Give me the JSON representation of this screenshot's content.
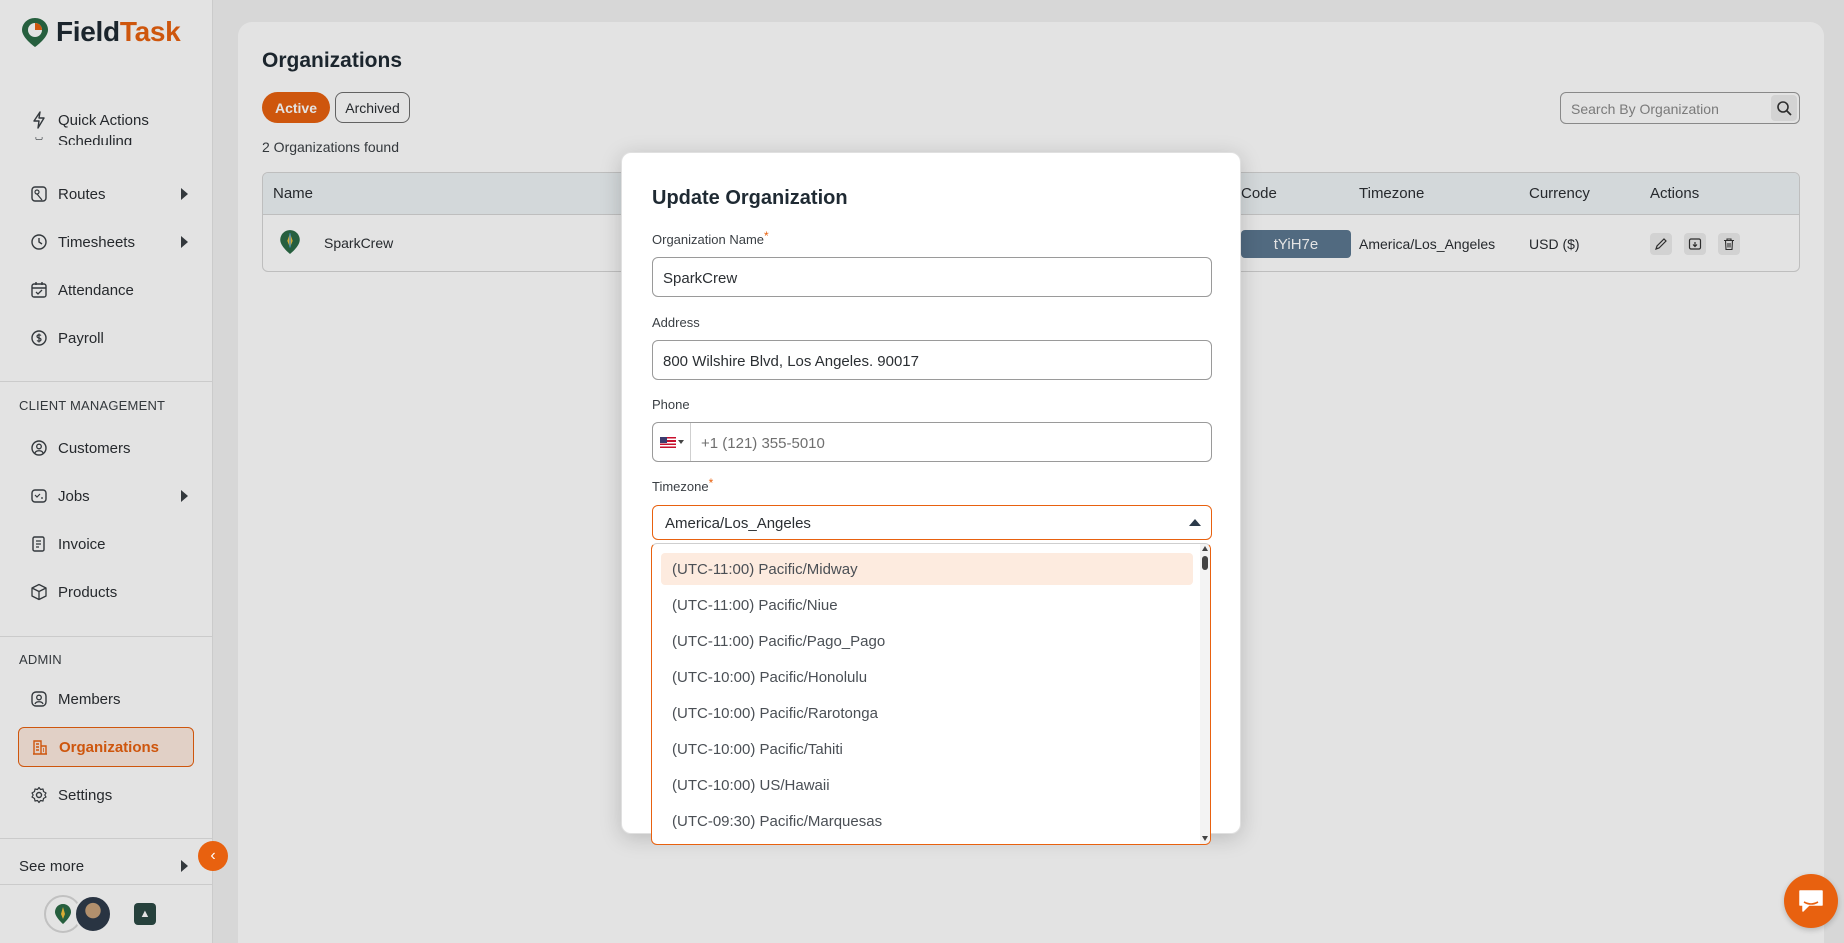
{
  "brand": {
    "name_main": "Field",
    "name_accent": "Task",
    "accent_color": "#e8610f"
  },
  "sidebar": {
    "items_top": [
      {
        "label": "Quick Actions",
        "icon": "bolt-icon"
      },
      {
        "label": "Scheduling",
        "icon": "calendar-icon"
      },
      {
        "label": "Routes",
        "icon": "map-icon"
      },
      {
        "label": "Timesheets",
        "icon": "clock-icon"
      },
      {
        "label": "Attendance",
        "icon": "calendar-check-icon"
      },
      {
        "label": "Payroll",
        "icon": "dollar-icon"
      }
    ],
    "client_section": "CLIENT MANAGEMENT",
    "client_items": [
      {
        "label": "Customers",
        "icon": "user-circle-icon"
      },
      {
        "label": "Jobs",
        "icon": "briefcase-icon"
      },
      {
        "label": "Invoice",
        "icon": "invoice-icon"
      },
      {
        "label": "Products",
        "icon": "box-icon"
      }
    ],
    "admin_section": "ADMIN",
    "admin_items": [
      {
        "label": "Members",
        "icon": "user-icon"
      },
      {
        "label": "Organizations",
        "icon": "building-icon"
      },
      {
        "label": "Settings",
        "icon": "gear-icon"
      }
    ],
    "see_more": "See more"
  },
  "page": {
    "title": "Organizations",
    "tabs": {
      "active": "Active",
      "archived": "Archived"
    },
    "found": "2 Organizations found",
    "search_placeholder": "Search By Organization"
  },
  "table": {
    "columns": {
      "name": "Name",
      "code": "Code",
      "timezone": "Timezone",
      "currency": "Currency",
      "actions": "Actions"
    },
    "rows": [
      {
        "name": "SparkCrew",
        "code": "tYiH7e",
        "timezone": "America/Los_Angeles",
        "currency": "USD ($)"
      }
    ]
  },
  "modal": {
    "title": "Update Organization",
    "org_name_label": "Organization Name",
    "org_name_value": "SparkCrew",
    "address_label": "Address",
    "address_value": "800 Wilshire Blvd, Los Angeles. 90017",
    "phone_label": "Phone",
    "phone_placeholder": "+1 (121) 355-5010",
    "timezone_label": "Timezone",
    "timezone_value": "America/Los_Angeles",
    "required_mark": "*"
  },
  "timezone_options": [
    "(UTC-11:00) Pacific/Midway",
    "(UTC-11:00) Pacific/Niue",
    "(UTC-11:00) Pacific/Pago_Pago",
    "(UTC-10:00) Pacific/Honolulu",
    "(UTC-10:00) Pacific/Rarotonga",
    "(UTC-10:00) Pacific/Tahiti",
    "(UTC-10:00) US/Hawaii",
    "(UTC-09:30) Pacific/Marquesas"
  ]
}
